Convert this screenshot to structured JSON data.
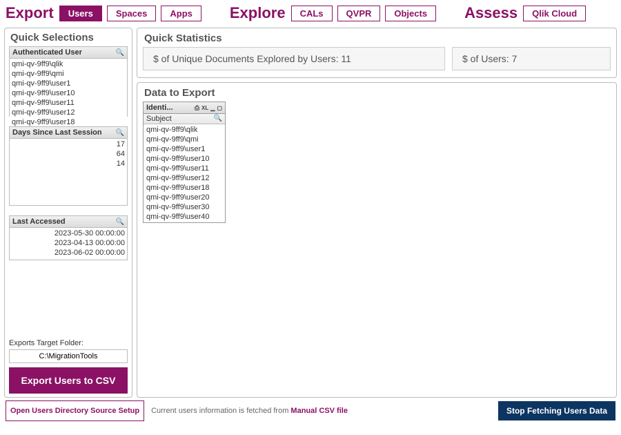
{
  "nav": {
    "export": {
      "title": "Export",
      "items": [
        "Users",
        "Spaces",
        "Apps"
      ],
      "active": 0
    },
    "explore": {
      "title": "Explore",
      "items": [
        "CALs",
        "QVPR",
        "Objects"
      ]
    },
    "assess": {
      "title": "Assess",
      "items": [
        "Qlik Cloud"
      ]
    }
  },
  "left": {
    "title": "Quick Selections",
    "auth": {
      "header": "Authenticated User",
      "rows": [
        "qmi-qv-9ff9\\qlik",
        "qmi-qv-9ff9\\qmi",
        "qmi-qv-9ff9\\user1",
        "qmi-qv-9ff9\\user10",
        "qmi-qv-9ff9\\user11",
        "qmi-qv-9ff9\\user12",
        "qmi-qv-9ff9\\user18"
      ]
    },
    "days": {
      "header": "Days Since Last Session",
      "rows": [
        "17",
        "64",
        "14"
      ]
    },
    "last": {
      "header": "Last Accessed",
      "rows": [
        "2023-05-30 00:00:00",
        "2023-04-13 00:00:00",
        "2023-06-02 00:00:00"
      ]
    },
    "target_label": "Exports Target Folder:",
    "target_value": "C:\\MigrationTools",
    "export_button": "Export Users to CSV"
  },
  "stats": {
    "title": "Quick Statistics",
    "docs_label": "$ of Unique Documents Explored by Users: ",
    "docs_value": "11",
    "users_label": "$ of Users: ",
    "users_value": "7"
  },
  "data": {
    "title": "Data to Export",
    "header": "Identi...",
    "xl": "XL",
    "sub": "Subject",
    "rows": [
      "qmi-qv-9ff9\\qlik",
      "qmi-qv-9ff9\\qmi",
      "qmi-qv-9ff9\\user1",
      "qmi-qv-9ff9\\user10",
      "qmi-qv-9ff9\\user11",
      "qmi-qv-9ff9\\user12",
      "qmi-qv-9ff9\\user18",
      "qmi-qv-9ff9\\user20",
      "qmi-qv-9ff9\\user30",
      "qmi-qv-9ff9\\user40"
    ]
  },
  "footer": {
    "open_source": "Open Users Directory Source Setup",
    "info_prefix": "Current users information is fetched from ",
    "info_link": "Manual CSV file",
    "stop": "Stop Fetching Users Data"
  }
}
